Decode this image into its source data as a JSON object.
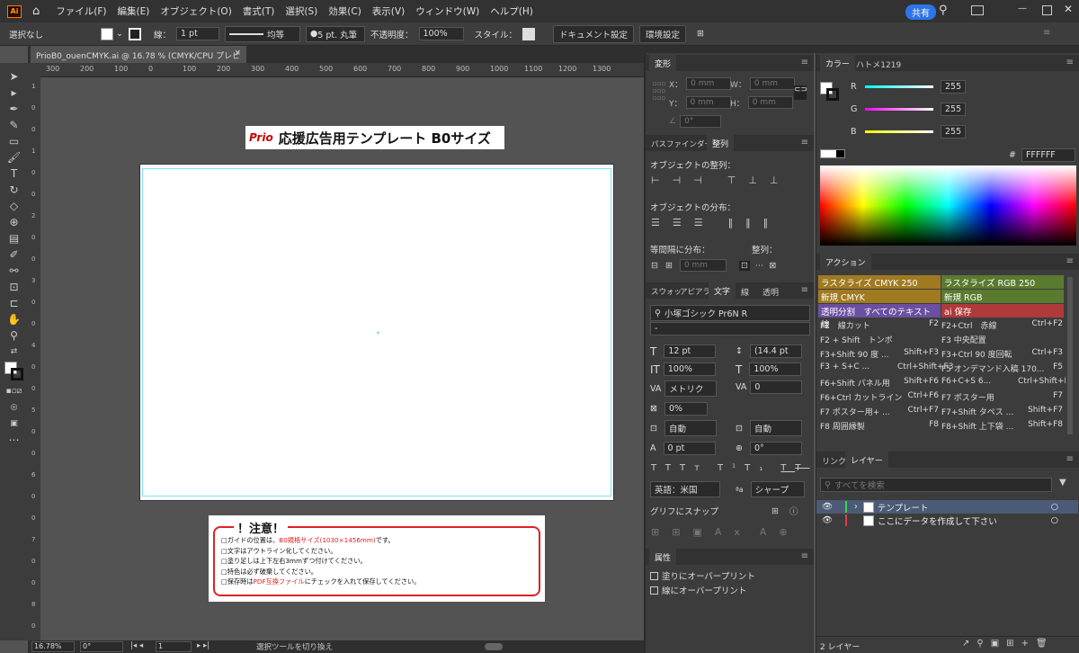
{
  "menubar": {
    "items": [
      "ファイル(F)",
      "編集(E)",
      "オブジェクト(O)",
      "書式(T)",
      "選択(S)",
      "効果(C)",
      "表示(V)",
      "ウィンドウ(W)",
      "ヘルプ(H)"
    ],
    "share": "共有",
    "logo": "Ai"
  },
  "control": {
    "selection": "選択なし",
    "stroke_label": "線：",
    "stroke_value": "1 pt",
    "uniform": "均等",
    "brush": "5 pt. 丸筆",
    "opacity_label": "不透明度：",
    "opacity_value": "100%",
    "style_label": "スタイル：",
    "doc_settings": "ドキュメント設定",
    "prefs": "環境設定"
  },
  "doc_tab": {
    "title": "PrioB0_ouenCMYK.ai @ 16.78 % (CMYK/CPU プレビュー)"
  },
  "ruler": {
    "h": [
      "300",
      "200",
      "100",
      "0",
      "100",
      "200",
      "300",
      "400",
      "500",
      "600",
      "700",
      "800",
      "900",
      "1000",
      "1100",
      "1200",
      "1300"
    ],
    "v": [
      "1",
      "0",
      "0",
      "1",
      "0",
      "0",
      "2",
      "0",
      "0",
      "3",
      "0",
      "0",
      "4",
      "0",
      "0",
      "5",
      "0",
      "0",
      "6",
      "0",
      "0",
      "7",
      "0",
      "0",
      "8",
      "0"
    ]
  },
  "artboard": {
    "logo_text": "Prio",
    "title": "応援広告用テンプレート B0サイズ"
  },
  "notice": {
    "title": "！注意！",
    "lines": [
      {
        "a": "□ガイドの位置は、",
        "r": "B0規格サイズ(1030×1456mm)",
        "b": "です。"
      },
      {
        "a": "□文字はアウトライン化してください。",
        "r": "",
        "b": ""
      },
      {
        "a": "□塗り足しは上下左右3mmずつ付けてください。",
        "r": "",
        "b": ""
      },
      {
        "a": "□特色は必ず破棄してください。",
        "r": "",
        "b": ""
      },
      {
        "a": "□保存時は",
        "r": "PDF互換ファイル",
        "b": "にチェックを入れて保存してください。"
      }
    ]
  },
  "status": {
    "zoom": "16.78%",
    "angle": "0°",
    "page": "1",
    "tool": "選択ツールを切り換え"
  },
  "transform": {
    "tab": "変形",
    "x": "X：",
    "y": "Y：",
    "w": "W：",
    "h": "H：",
    "xv": "0 mm",
    "yv": "0 mm",
    "wv": "0 mm",
    "hv": "0 mm",
    "angle": "0°"
  },
  "align": {
    "tab1": "パスファインダー",
    "tab2": "整列",
    "align_objects": "オブジェクトの整列：",
    "distribute_objects": "オブジェクトの分布：",
    "distribute_spacing": "等間隔に分布：",
    "align_to": "整列：",
    "spacing": "0 mm"
  },
  "character": {
    "tabs": [
      "スウォッ",
      "アピアラ",
      "文字",
      "線",
      "透明"
    ],
    "font": "小塚ゴシック Pr6N R",
    "style": "-",
    "size": "12 pt",
    "leading": "(14.4 pt",
    "hscale": "100%",
    "vscale": "100%",
    "kerning": "メトリク",
    "tracking": "0",
    "tsume": "0%",
    "aki1": "自動",
    "aki2": "自動",
    "baseline": "0 pt",
    "rotate": "0°",
    "language": "英語：米国",
    "aa": "シャープ",
    "snap": "グリフにスナップ"
  },
  "attributes": {
    "tab": "属性",
    "fill_overprint": "塗りにオーバープリント",
    "stroke_overprint": "線にオーバープリント"
  },
  "color": {
    "tab1": "カラー",
    "tab2": "ハトメ1219",
    "r": "R",
    "g": "G",
    "b": "B",
    "rv": "255",
    "gv": "255",
    "bv": "255",
    "hex_label": "#",
    "hex": "FFFFFF",
    "colors": {
      "r": "#00e0e8",
      "g": "#39d353",
      "b": "#e6e600"
    }
  },
  "actions": {
    "tab": "アクション",
    "colored": [
      {
        "l": "ラスタライズ CMYK 250",
        "c": "#a07a20"
      },
      {
        "l": "ラスタライズ RGB 250",
        "c": "#5a7a30"
      },
      {
        "l": "新規 CMYK",
        "c": "#a07a20"
      },
      {
        "l": "新規 RGB",
        "c": "#5a7a30"
      },
      {
        "l": "透明分割　すべてのテキスト線",
        "c": "#6b4fa0"
      },
      {
        "l": "ai 保存",
        "c": "#b03a3a"
      }
    ],
    "rows": [
      [
        "F2　線カット",
        "F2",
        "F2+Ctrl　赤線",
        "Ctrl+F2"
      ],
      [
        "F2 + Shift　トンボ",
        "",
        "F3 中央配置",
        ""
      ],
      [
        "F3+Shift 90 度 ...",
        "Shift+F3",
        "F3+Ctrl 90 度回転",
        "Ctrl+F3"
      ],
      [
        "F3 + S+C ...",
        "Ctrl+Shift+F3",
        "F5 オンデマンド入稿 170...",
        "F5"
      ],
      [
        "F6+Shift パネル用",
        "Shift+F6",
        "F6+C+S 6...",
        "Ctrl+Shift+F6"
      ],
      [
        "F6+Ctrl カットライン",
        "Ctrl+F6",
        "F7 ポスター用",
        "F7"
      ],
      [
        "F7 ポスター用+ ...",
        "Ctrl+F7",
        "F7+Shift タペス ...",
        "Shift+F7"
      ],
      [
        "F8 周囲縁製",
        "F8",
        "F8+Shift 上下袋 ...",
        "Shift+F8"
      ]
    ]
  },
  "layers": {
    "tab1": "リンク",
    "tab2": "レイヤー",
    "search": "すべてを検索",
    "items": [
      {
        "name": "テンプレート",
        "color": "#39d353"
      },
      {
        "name": "ここにデータを作成して下さい",
        "color": "#e04040"
      }
    ],
    "count": "2 レイヤー"
  }
}
